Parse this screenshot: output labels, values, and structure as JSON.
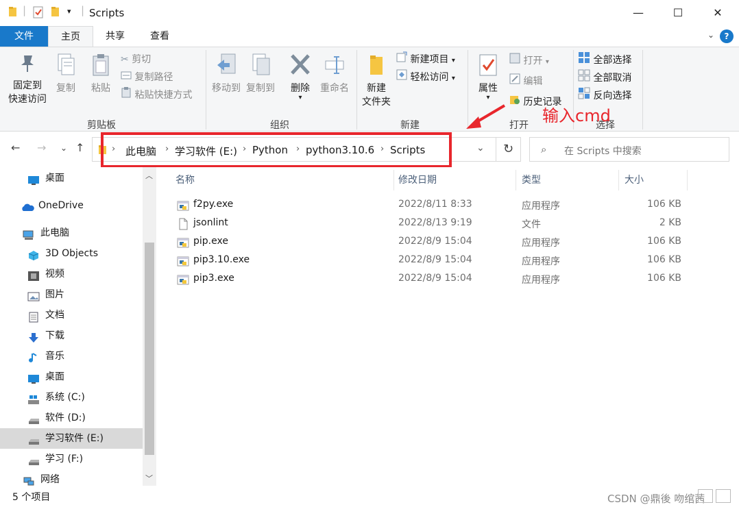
{
  "window": {
    "title": "Scripts",
    "minimize_glyph": "—",
    "maximize_glyph": "☐",
    "close_glyph": "✕"
  },
  "ribbon_tabs": [
    {
      "label": "文件"
    },
    {
      "label": "主页"
    },
    {
      "label": "共享"
    },
    {
      "label": "查看"
    }
  ],
  "ribbon": {
    "clipboard": {
      "pin_label_1": "固定到",
      "pin_label_2": "快速访问",
      "copy_label": "复制",
      "paste_label": "粘贴",
      "cut_label": "剪切",
      "copy_path_label": "复制路径",
      "paste_shortcut_label": "粘贴快捷方式",
      "group_label": "剪贴板"
    },
    "organize": {
      "move_to_label": "移动到",
      "copy_to_label": "复制到",
      "delete_label": "删除",
      "rename_label": "重命名",
      "group_label": "组织"
    },
    "new": {
      "new_folder_label_1": "新建",
      "new_folder_label_2": "文件夹",
      "new_item_label": "新建项目",
      "easy_access_label": "轻松访问",
      "group_label": "新建"
    },
    "open": {
      "properties_label": "属性",
      "open_label": "打开",
      "edit_label": "编辑",
      "history_label": "历史记录",
      "group_label": "打开"
    },
    "select": {
      "select_all_label": "全部选择",
      "select_none_label": "全部取消",
      "invert_label": "反向选择",
      "group_label": "选择"
    }
  },
  "address_bar": {
    "breadcrumbs": [
      "此电脑",
      "学习软件 (E:)",
      "Python",
      "python3.10.6",
      "Scripts"
    ],
    "search_placeholder": "在 Scripts 中搜索"
  },
  "annotation": {
    "text": "输入cmd",
    "color": "#e8262c"
  },
  "nav_pane": {
    "items": [
      {
        "label": "桌面",
        "icon": "desktop-icon"
      },
      {
        "label": "OneDrive",
        "icon": "cloud-icon"
      },
      {
        "label": "此电脑",
        "icon": "computer-icon"
      },
      {
        "label": "3D Objects",
        "icon": "cube-icon"
      },
      {
        "label": "视频",
        "icon": "video-icon"
      },
      {
        "label": "图片",
        "icon": "picture-icon"
      },
      {
        "label": "文档",
        "icon": "document-icon"
      },
      {
        "label": "下载",
        "icon": "download-icon"
      },
      {
        "label": "音乐",
        "icon": "music-icon"
      },
      {
        "label": "桌面",
        "icon": "desktop-icon"
      },
      {
        "label": "系统 (C:)",
        "icon": "system-drive-icon"
      },
      {
        "label": "软件 (D:)",
        "icon": "drive-icon"
      },
      {
        "label": "学习软件 (E:)",
        "icon": "drive-icon",
        "selected": true
      },
      {
        "label": "学习 (F:)",
        "icon": "drive-icon"
      },
      {
        "label": "网络",
        "icon": "network-icon"
      }
    ]
  },
  "file_list": {
    "columns": [
      "名称",
      "修改日期",
      "类型",
      "大小"
    ],
    "files": [
      {
        "name": "f2py.exe",
        "date": "2022/8/11 8:33",
        "type": "应用程序",
        "size": "106 KB",
        "icon": "python-exe-icon"
      },
      {
        "name": "jsonlint",
        "date": "2022/8/13 9:19",
        "type": "文件",
        "size": "2 KB",
        "icon": "blank-file-icon"
      },
      {
        "name": "pip.exe",
        "date": "2022/8/9 15:04",
        "type": "应用程序",
        "size": "106 KB",
        "icon": "python-exe-icon"
      },
      {
        "name": "pip3.10.exe",
        "date": "2022/8/9 15:04",
        "type": "应用程序",
        "size": "106 KB",
        "icon": "python-exe-icon"
      },
      {
        "name": "pip3.exe",
        "date": "2022/8/9 15:04",
        "type": "应用程序",
        "size": "106 KB",
        "icon": "python-exe-icon"
      }
    ]
  },
  "status_bar": {
    "item_count": "5 个项目",
    "watermark": "CSDN @鼎後 吻绾茜"
  }
}
